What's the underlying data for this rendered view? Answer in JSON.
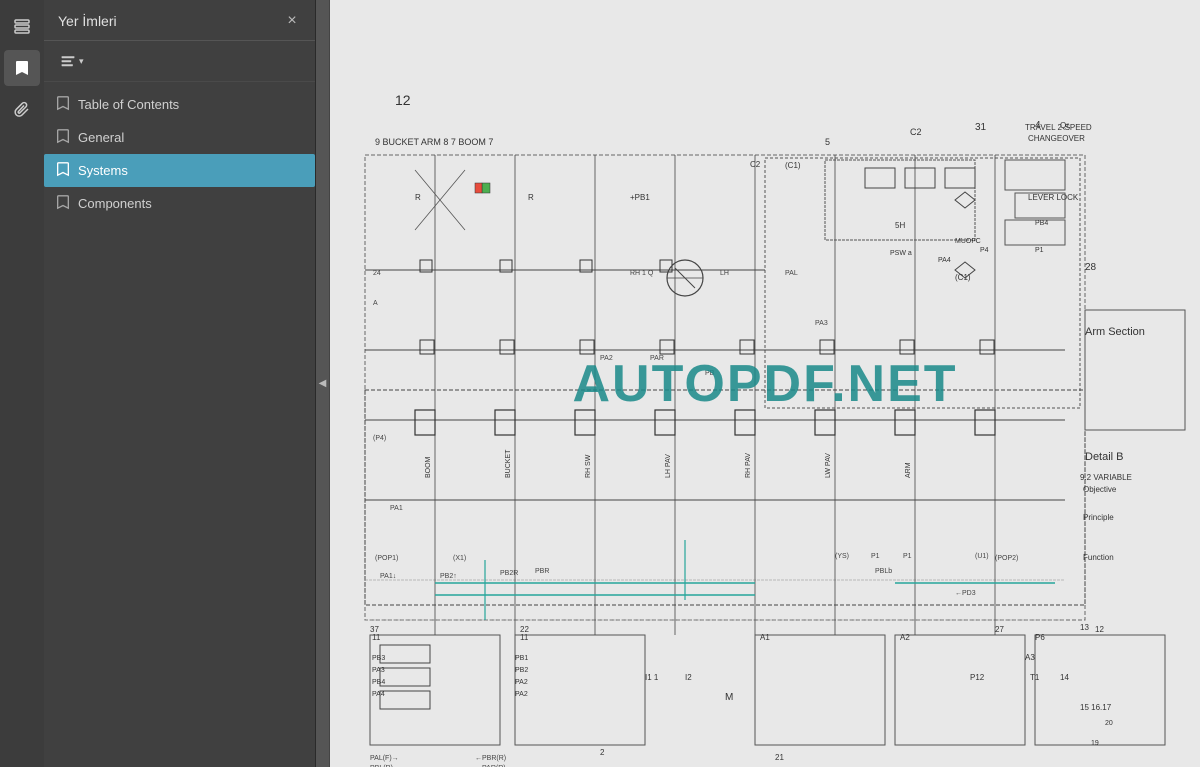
{
  "iconBar": {
    "buttons": [
      {
        "name": "layers-icon",
        "symbol": "⧉",
        "active": false
      },
      {
        "name": "bookmark-icon",
        "symbol": "🔖",
        "active": true
      },
      {
        "name": "paperclip-icon",
        "symbol": "📎",
        "active": false
      }
    ]
  },
  "sidebar": {
    "title": "Yer İmleri",
    "closeLabel": "×",
    "toolbarDropdownLabel": "≡",
    "toolbarChevron": "▾",
    "items": [
      {
        "label": "Table of Contents",
        "active": false
      },
      {
        "label": "General",
        "active": false
      },
      {
        "label": "Systems",
        "active": true
      },
      {
        "label": "Components",
        "active": false
      }
    ]
  },
  "collapseArrow": "◀",
  "watermark": {
    "text": "AUTOPDF.NET"
  },
  "diagram": {
    "pageNumber": "12",
    "label1": "9 BUCKET ARM 8 7 BOOM 7",
    "label2": "TRAVEL 2-SPEED CHANGEOVER",
    "label3": "LEVER LOCK",
    "label4": "Arm Section",
    "label5": "Detail B",
    "label6": "9.2 VARIABLE",
    "label7": "Objective",
    "label8": "Principle",
    "label9": "Function"
  }
}
